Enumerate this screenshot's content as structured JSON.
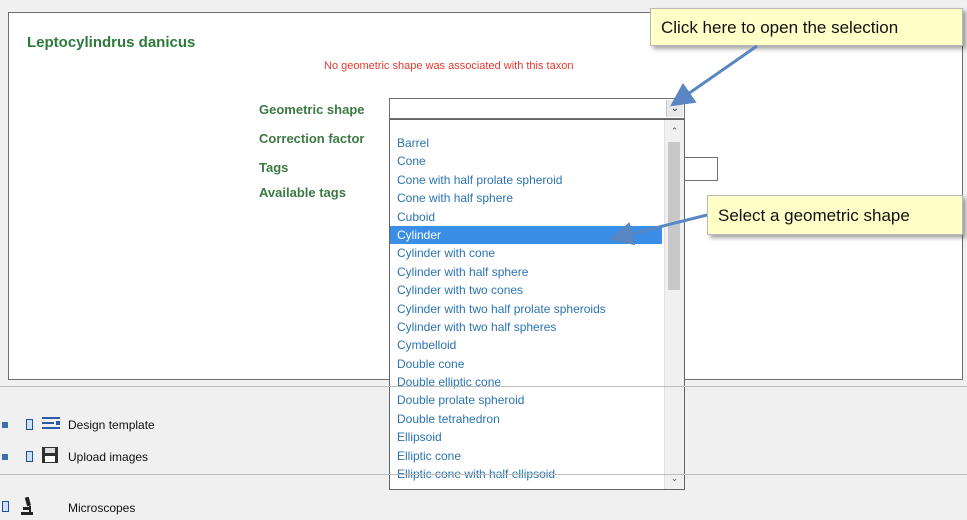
{
  "taxon": {
    "name": "Leptocylindrus danicus"
  },
  "warning": "No geometric shape was associated with this taxon",
  "form": {
    "geometric_shape_label": "Geometric shape",
    "correction_factor_label": "Correction factor",
    "tags_label": "Tags",
    "available_tags_label": "Available tags",
    "geometric_shape_value": ""
  },
  "dropdown": {
    "options": [
      {
        "label": "Barrel"
      },
      {
        "label": "Cone"
      },
      {
        "label": "Cone with half prolate spheroid"
      },
      {
        "label": "Cone with half sphere"
      },
      {
        "label": "Cuboid"
      },
      {
        "label": "Cylinder",
        "selected": true
      },
      {
        "label": "Cylinder with cone"
      },
      {
        "label": "Cylinder with half sphere"
      },
      {
        "label": "Cylinder with two cones"
      },
      {
        "label": "Cylinder with two half prolate spheroids"
      },
      {
        "label": "Cylinder with two half spheres"
      },
      {
        "label": "Cymbelloid"
      },
      {
        "label": "Double cone"
      },
      {
        "label": "Double elliptic cone"
      },
      {
        "label": "Double prolate spheroid"
      },
      {
        "label": "Double tetrahedron"
      },
      {
        "label": "Ellipsoid"
      },
      {
        "label": "Elliptic cone"
      },
      {
        "label": "Elliptic cone with half ellipsoid"
      }
    ]
  },
  "callouts": {
    "open": "Click here to open the selection",
    "select": "Select a geometric shape"
  },
  "tree": {
    "design_template": "Design template",
    "upload_images": "Upload images",
    "microscopes": "Microscopes"
  },
  "colors": {
    "accent": "#3a8ee6",
    "warning": "#e53a2f",
    "label": "#3c7a44",
    "arrow": "#5b86c4"
  }
}
